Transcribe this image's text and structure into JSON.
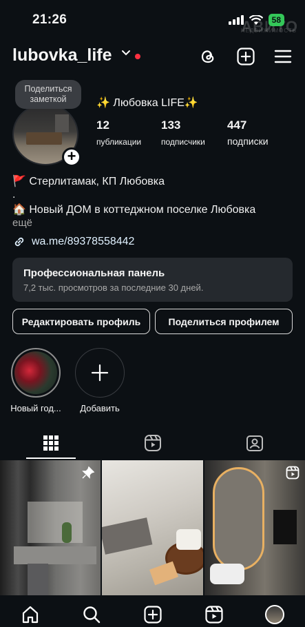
{
  "status": {
    "time": "21:26",
    "battery": "58",
    "watermark": "АВИТО",
    "watermark_sub": "НЕДВИЖИМОСТЬ"
  },
  "header": {
    "username": "lubovka_life"
  },
  "profile": {
    "note": "Поделиться заметкой",
    "display_name": "✨ Любовка LIFE✨",
    "stats": [
      {
        "num": "12",
        "label": "публикации"
      },
      {
        "num": "133",
        "label": "подписчики"
      },
      {
        "num": "447",
        "label": "подписки"
      }
    ],
    "bio_line1": "🚩 Стерлитамак, КП Любовка",
    "bio_line2": ".",
    "bio_line3": "🏠 Новый ДОМ в коттеджном поселке Любовка",
    "bio_more": "ещё",
    "link": "wa.me/89378558442"
  },
  "pro_panel": {
    "title": "Профессиональная панель",
    "subtitle": "7,2 тыс. просмотров за последние 30 дней."
  },
  "buttons": {
    "edit": "Редактировать профиль",
    "share": "Поделиться профилем"
  },
  "highlights": [
    {
      "label": "Новый год..."
    },
    {
      "label": "Добавить"
    }
  ],
  "colors": {
    "background": "#0c1014",
    "panel": "#25292e",
    "accent_red": "#ff3040",
    "battery_green": "#34c759"
  }
}
